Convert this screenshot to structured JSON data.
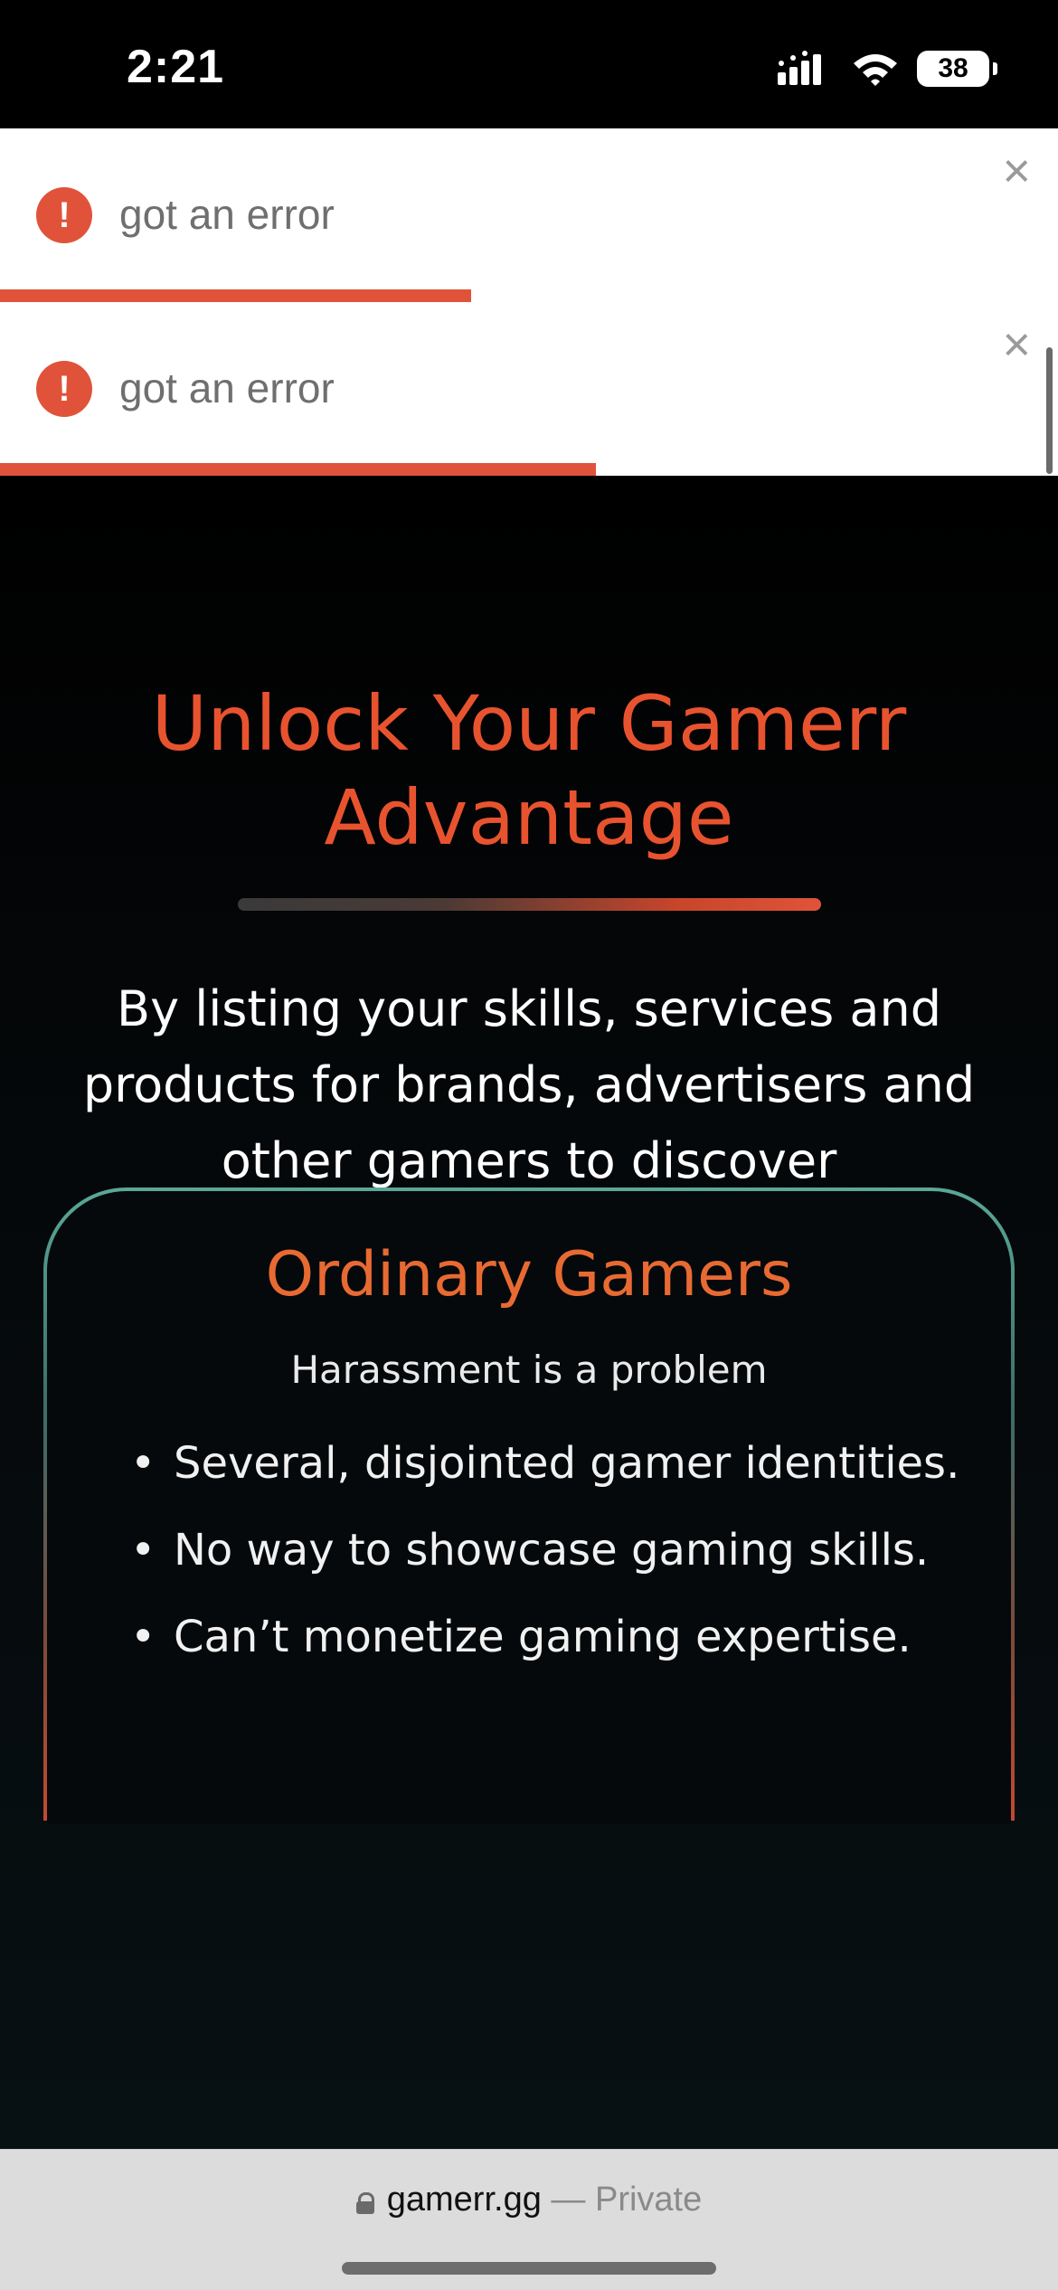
{
  "status_bar": {
    "time": "2:21",
    "battery": "38"
  },
  "toasts": [
    {
      "message": "got an error",
      "icon": "exclamation-icon",
      "close_label": "×",
      "progress_pct": 44.5
    },
    {
      "message": "got an error",
      "icon": "exclamation-icon",
      "close_label": "×",
      "progress_pct": 56.3
    }
  ],
  "hero": {
    "title": "Unlock Your Gamerr Advantage",
    "subtitle": "By listing your skills, services and products for brands, advertisers and other gamers to discover"
  },
  "card": {
    "title": "Ordinary Gamers",
    "subtitle": "Harassment is a problem",
    "items": [
      "Several, disjointed gamer identities.",
      "No way to showcase gaming skills.",
      "Can’t monetize gaming expertise."
    ]
  },
  "browser": {
    "domain": "gamerr.gg",
    "separator": " — ",
    "mode": "Private"
  },
  "colors": {
    "accent": "#e8532f",
    "error": "#e0533a",
    "card_title": "#e86a33"
  }
}
